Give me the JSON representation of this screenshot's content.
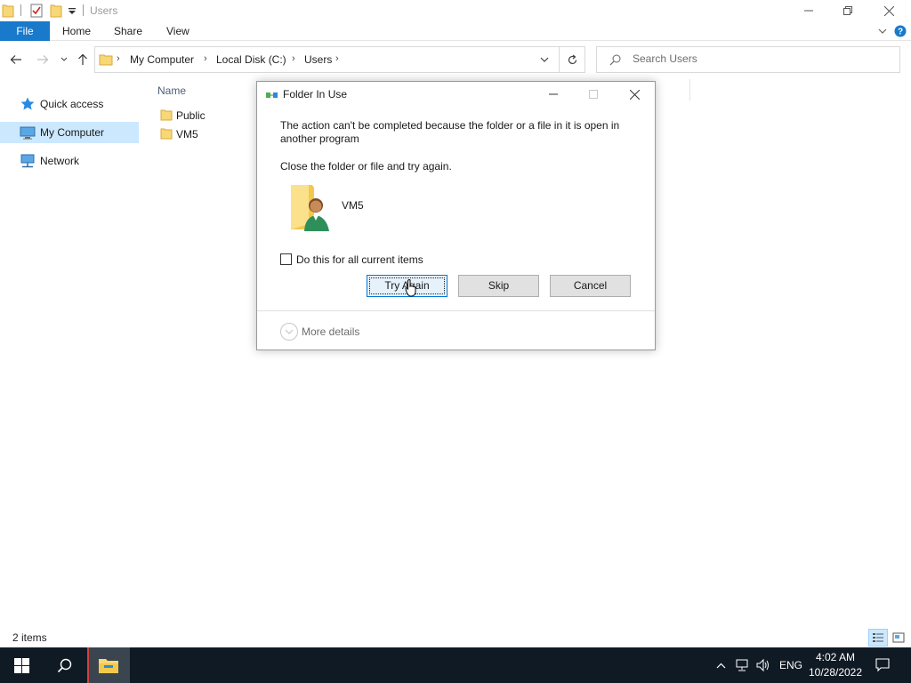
{
  "window": {
    "title": "Users",
    "controls": [
      "minimize",
      "restore",
      "close"
    ]
  },
  "ribbon": {
    "tabs": [
      "File",
      "Home",
      "Share",
      "View"
    ]
  },
  "address_bar": {
    "breadcrumbs": [
      "My Computer",
      "Local Disk (C:)",
      "Users"
    ]
  },
  "search": {
    "placeholder": "Search Users"
  },
  "sidebar": {
    "items": [
      {
        "label": "Quick access",
        "icon": "star-icon",
        "selected": false
      },
      {
        "label": "My Computer",
        "icon": "computer-icon",
        "selected": true
      },
      {
        "label": "Network",
        "icon": "network-icon",
        "selected": false
      }
    ]
  },
  "content": {
    "column_header": "Name",
    "files": [
      {
        "name": "Public",
        "type": "folder"
      },
      {
        "name": "VM5",
        "type": "folder"
      }
    ]
  },
  "status": {
    "item_count": "2 items"
  },
  "dialog": {
    "title": "Folder In Use",
    "message_line1": "The action can't be completed because the folder or a file in it is open in",
    "message_line2": "another program",
    "instruction": "Close the folder or file and try again.",
    "item_name": "VM5",
    "checkbox_label": "Do this for all current items",
    "checkbox_checked": false,
    "buttons": {
      "try_again": "Try Again",
      "skip": "Skip",
      "cancel": "Cancel"
    },
    "more_details": "More details"
  },
  "taskbar": {
    "language": "ENG",
    "time": "4:02 AM",
    "date": "10/28/2022"
  },
  "colors": {
    "accent": "#1979ca",
    "selection": "#cce8ff",
    "taskbar": "#101a24",
    "folder": "#f8d775"
  }
}
